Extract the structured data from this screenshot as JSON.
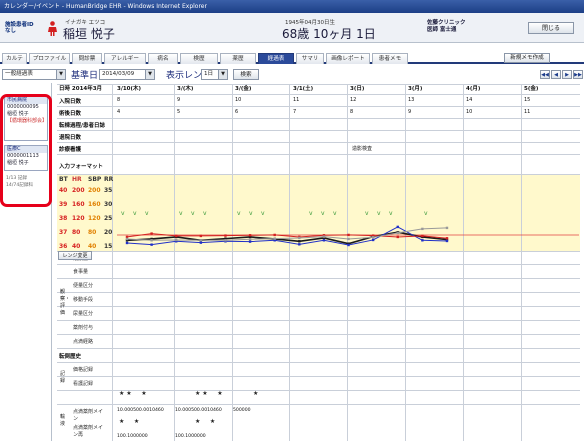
{
  "window": {
    "title": "カレンダー/イベント - HumanBridge EHR - Windows Internet Explorer"
  },
  "patient": {
    "id_line1": "施設患者ID",
    "id_line2": "なし",
    "kana": "イナガキ エツコ",
    "name": "稲垣 悦子",
    "birth": "1945年04月30日生",
    "age": "68歳 10ヶ月 1日",
    "clinic_line1": "佐藤クリニック",
    "clinic_line2": "医師 富士通",
    "close": "閉じる"
  },
  "tabs": [
    "カルテ",
    "プロファイル",
    "問診票",
    "アレルギー",
    "病名",
    "検歴",
    "薬歴",
    "経過表",
    "サマリ",
    "画像レポート",
    "患者メモ"
  ],
  "active_tab": "経過表",
  "new_memo": "新規メモ作成",
  "toolbar": {
    "view": "一般経過表",
    "base_label": "基準日",
    "date": "2014/03/09",
    "range_label": "表示レンジ",
    "range": "1日",
    "search": "検索",
    "nav": [
      "◀◀",
      "◀",
      "▶",
      "▶▶"
    ]
  },
  "sidebar": {
    "card1": {
      "hospital": "市民病院",
      "pid": "0000000095",
      "name": "稲垣 悦子",
      "tag": "【循環器科部会】"
    },
    "card2": {
      "hospital": "医療C",
      "pid": "0000001113",
      "name": "稲垣 悦子"
    },
    "note1": "1/13 記録",
    "note2": "14/74記録科"
  },
  "table": {
    "header_label": "日時 2014年3月",
    "days": [
      "3/10(木)",
      "3/(木)",
      "3/(金)",
      "3/1(土)",
      "3(日)",
      "3(月)",
      "4(月)",
      "5(金)"
    ],
    "rows": {
      "admit": "入院日数",
      "admit_vals": [
        "8",
        "9",
        "10",
        "11",
        "12",
        "13",
        "14",
        "15"
      ],
      "post": "術後日数",
      "post_vals": [
        "4",
        "5",
        "6",
        "7",
        "8",
        "9",
        "10",
        "11"
      ],
      "event": "転棟過程/患者日誌",
      "discharge": "退院日数",
      "surgery": "診療看護",
      "surgery_note": "造影検査",
      "input": "入力フォーマット"
    },
    "vital_axes": {
      "bt": "BT",
      "hr": "HR",
      "sbp": "SBP",
      "rr": "RR"
    },
    "vital_scale": [
      [
        "40",
        "200",
        "200",
        "35"
      ],
      [
        "39",
        "160",
        "160",
        "30"
      ],
      [
        "38",
        "120",
        "120",
        "25"
      ],
      [
        "37",
        "80",
        "80",
        "20"
      ],
      [
        "36",
        "40",
        "40",
        "15"
      ]
    ],
    "legend_btn": "レンジ変更",
    "lower_rows": [
      "酸素量",
      "食事量",
      "便量区分",
      "移動手段",
      "尿量区分",
      "薬剤付与",
      "点滴経路"
    ],
    "group_label": "観察・評価",
    "extra_rows": [
      "転倒歴史",
      "価格記録",
      "看護記録"
    ],
    "group2": "記録",
    "bottom_rows": [
      "点滴薬剤メイン",
      "点滴薬剤メイン再"
    ],
    "group3": "輸液",
    "infusion": [
      "10.000500.0010460",
      "10.000500.0010460",
      "500000"
    ],
    "infusion2": [
      "100.1000000",
      "100.1000000"
    ]
  },
  "chart_data": {
    "type": "line",
    "series": [
      {
        "color": "#1a1a1a",
        "values": [
          17.6,
          18.0,
          18.6,
          17.6,
          18.1,
          18.6,
          18.0,
          17.3,
          18.3,
          16.6,
          18.7,
          20.0,
          18.6,
          17.8
        ]
      },
      {
        "color": "#2030c8",
        "values": [
          16.8,
          16.3,
          17.3,
          16.9,
          17.3,
          17.2,
          17.6,
          16.4,
          17.6,
          16.2,
          17.7,
          21.6,
          17.6,
          17.4
        ]
      },
      {
        "color": "#d42020",
        "values": [
          18.6,
          19.6,
          18.9,
          18.9,
          19.0,
          19.1,
          19.2,
          18.6,
          19.1,
          19.2,
          19.0,
          18.6,
          18.9,
          18.2
        ]
      },
      {
        "color": "#999999",
        "values": [
          18.0,
          17.6,
          17.7,
          17.6,
          17.6,
          17.9,
          18.1,
          18.3,
          18.7,
          18.0,
          18.5,
          19.8,
          21.0,
          21.3
        ]
      }
    ],
    "ylim": [
      15,
      35
    ],
    "x": [
      "1",
      "2",
      "3",
      "4",
      "5",
      "6",
      "7",
      "8",
      "9",
      "10",
      "11",
      "12",
      "13",
      "14"
    ]
  }
}
